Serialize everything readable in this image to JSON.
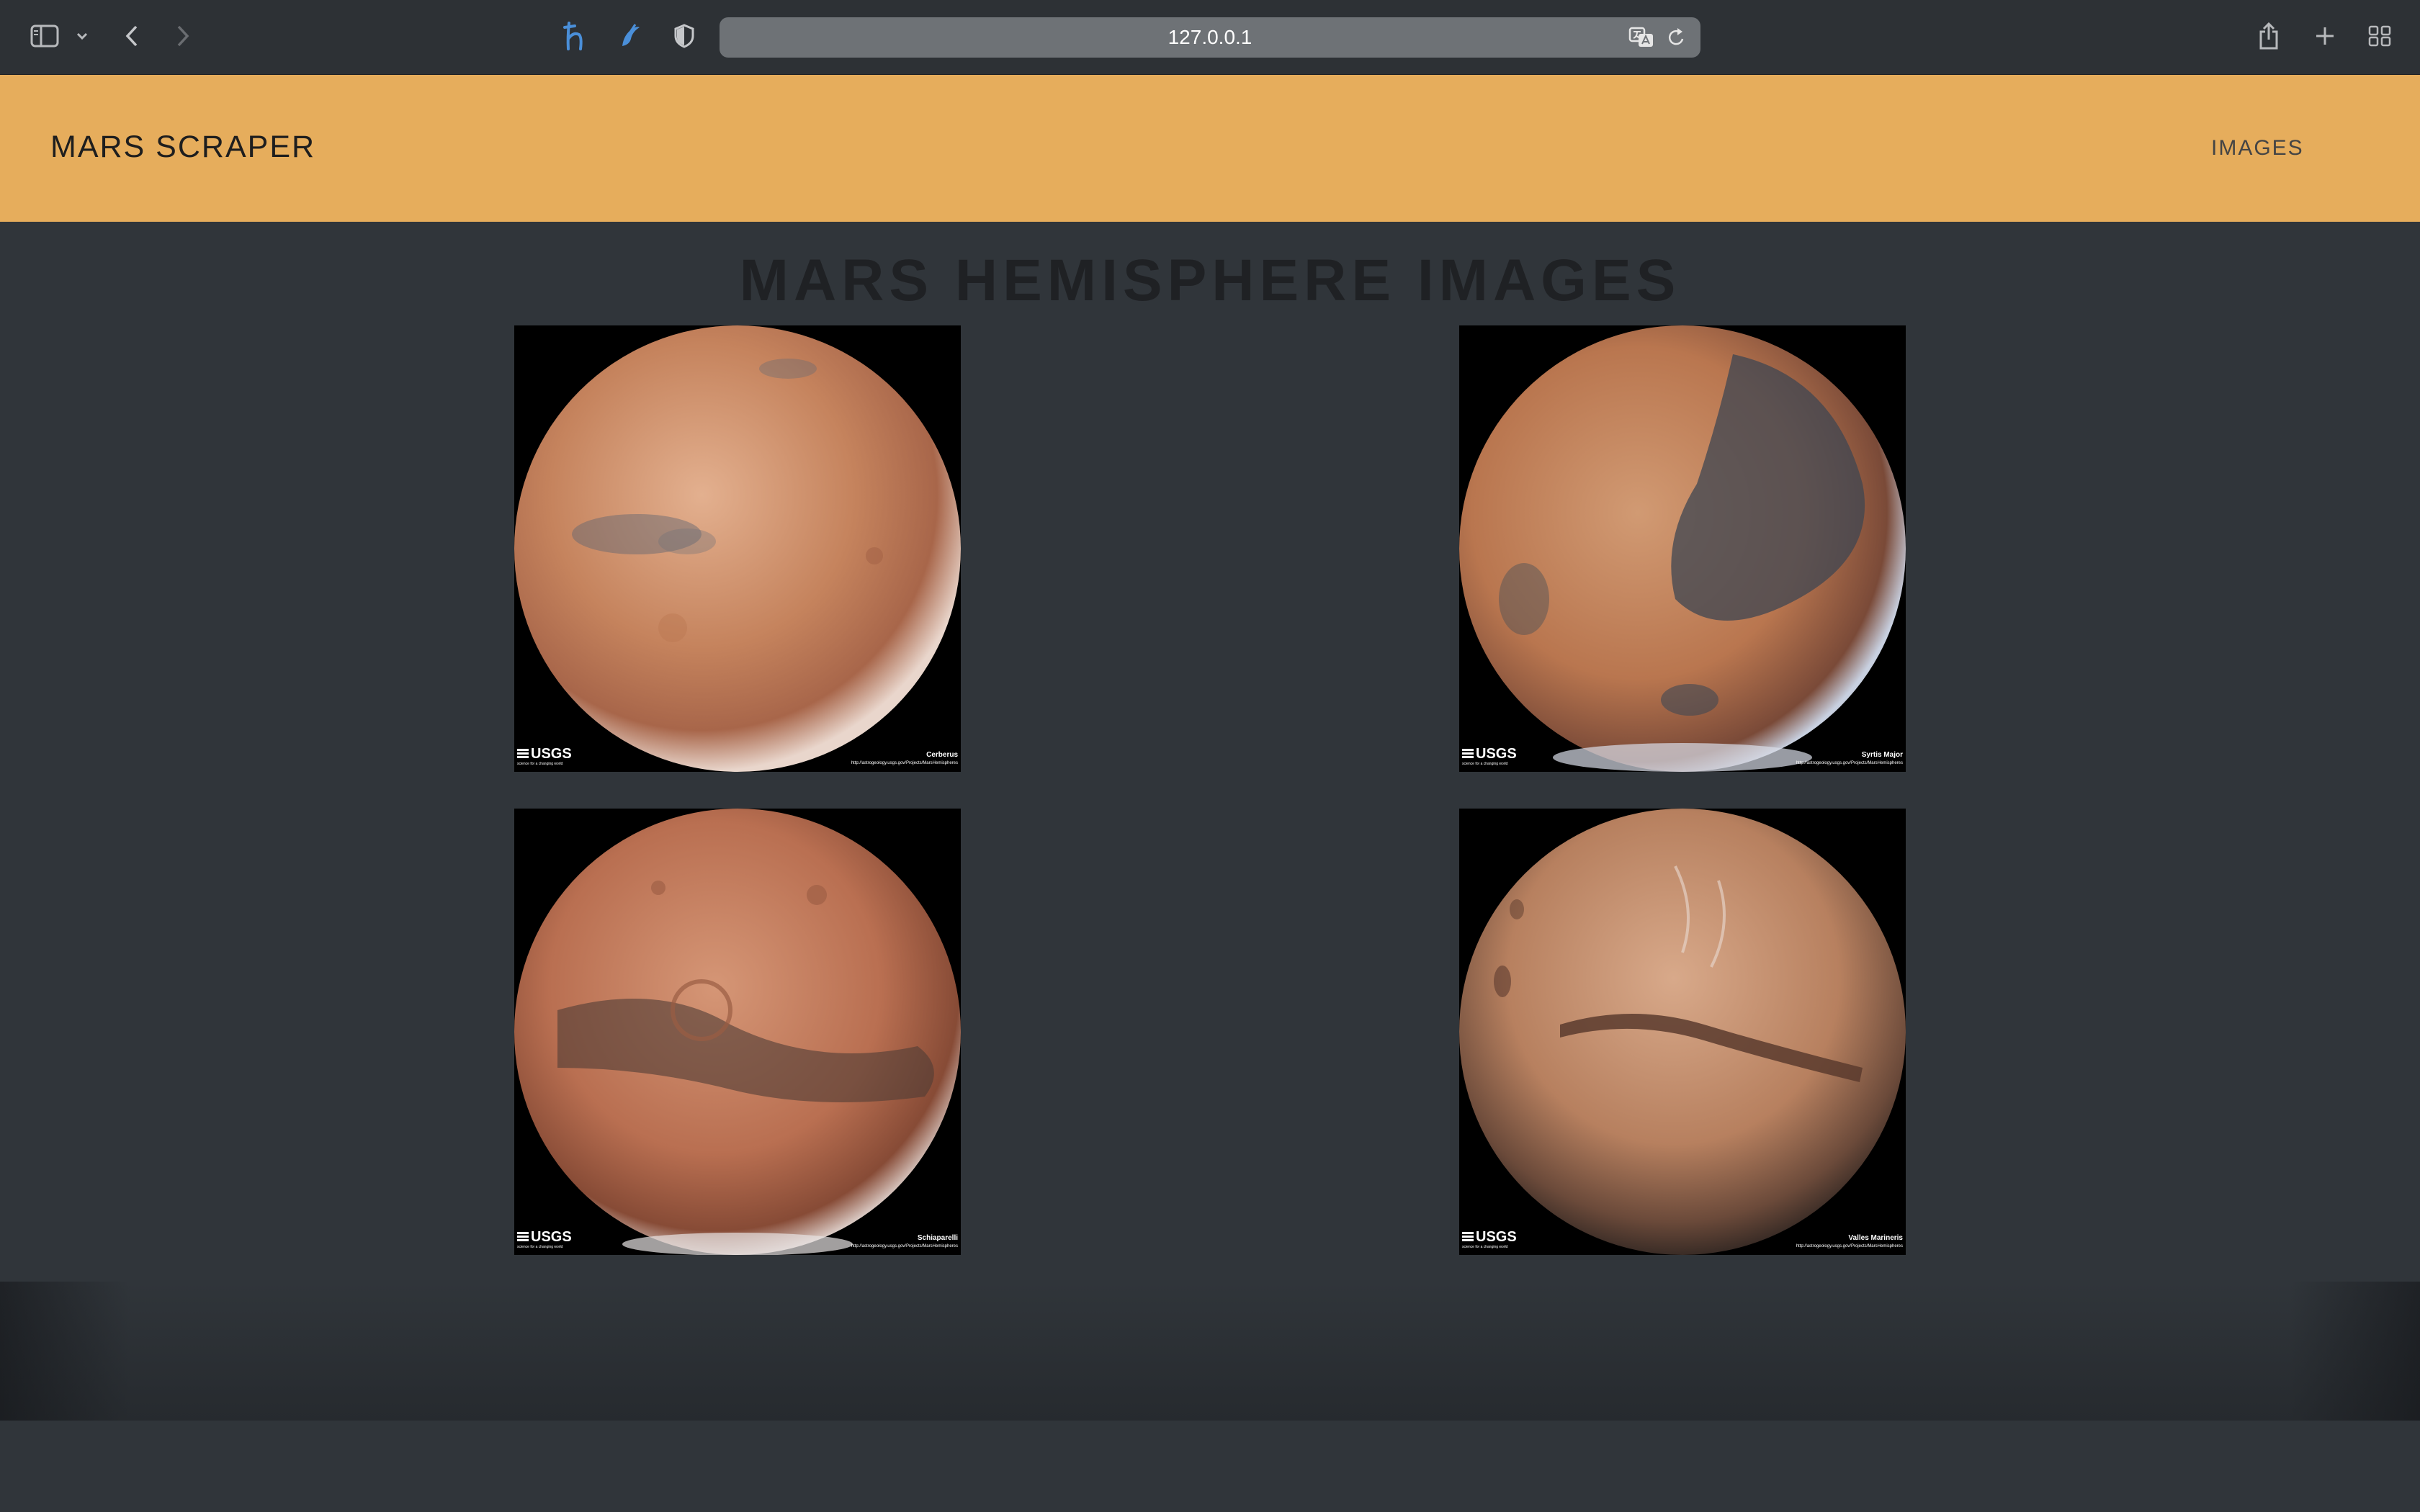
{
  "browser": {
    "url": "127.0.0.1"
  },
  "site": {
    "brand": "MARS SCRAPER",
    "nav": {
      "images_label": "IMAGES"
    }
  },
  "page": {
    "title": "MARS HEMISPHERE IMAGES"
  },
  "hemispheres": [
    {
      "name": "Cerberus",
      "logo": "USGS",
      "logo_sub": "science for a changing world",
      "link": "http://astrogeology.usgs.gov/Projects/MarsHemispheres"
    },
    {
      "name": "Syrtis Major",
      "logo": "USGS",
      "logo_sub": "science for a changing world",
      "link": "http://astrogeology.usgs.gov/Projects/MarsHemispheres"
    },
    {
      "name": "Schiaparelli",
      "logo": "USGS",
      "logo_sub": "science for a changing world",
      "link": "http://astrogeology.usgs.gov/Projects/MarsHemispheres"
    },
    {
      "name": "Valles Marineris",
      "logo": "USGS",
      "logo_sub": "science for a changing world",
      "link": "http://astrogeology.usgs.gov/Projects/MarsHemispheres"
    }
  ],
  "colors": {
    "header_bg": "#e6ad5c",
    "page_bg": "#30353a",
    "chrome_bg": "#2d3135",
    "accent_icon": "#4a8fd9"
  },
  "icons": {
    "sidebar": "sidebar-icon",
    "back": "chevron-left-icon",
    "forward": "chevron-right-icon",
    "translate": "translate-icon",
    "reload": "reload-icon",
    "share": "share-icon",
    "new_tab": "plus-icon",
    "tab_overview": "grid-icon"
  }
}
